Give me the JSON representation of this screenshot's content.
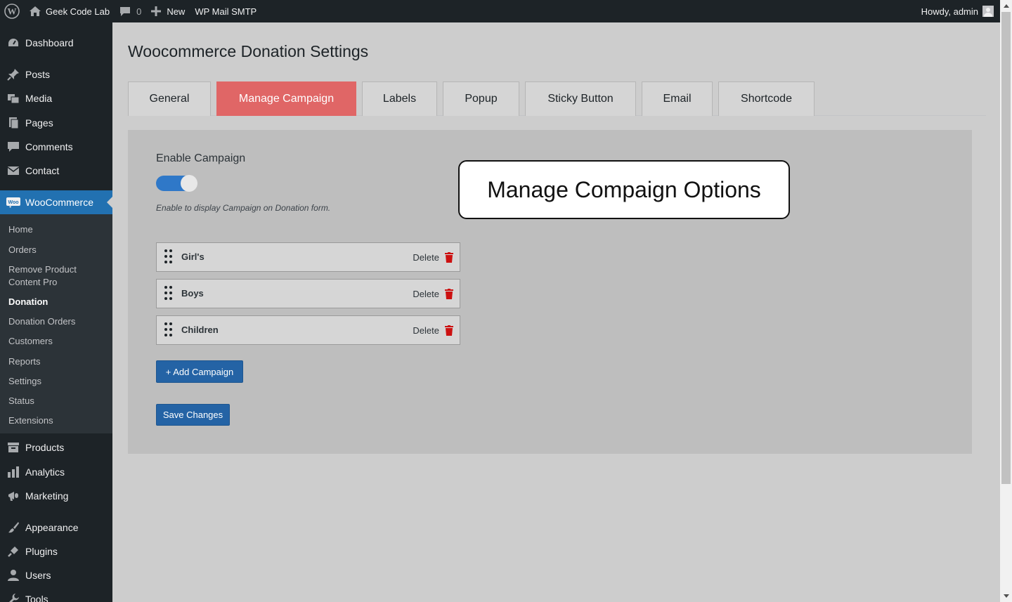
{
  "adminbar": {
    "site_name": "Geek Code Lab",
    "comments_count": "0",
    "new_label": "New",
    "smtp_label": "WP Mail SMTP",
    "howdy": "Howdy, admin"
  },
  "sidebar": {
    "items": {
      "dashboard": "Dashboard",
      "posts": "Posts",
      "media": "Media",
      "pages": "Pages",
      "comments": "Comments",
      "contact": "Contact",
      "woocommerce": "WooCommerce",
      "products": "Products",
      "analytics": "Analytics",
      "marketing": "Marketing",
      "appearance": "Appearance",
      "plugins": "Plugins",
      "users": "Users",
      "tools": "Tools"
    },
    "submenu": {
      "home": "Home",
      "orders": "Orders",
      "remove_product": "Remove Product Content Pro",
      "donation": "Donation",
      "donation_orders": "Donation Orders",
      "customers": "Customers",
      "reports": "Reports",
      "settings": "Settings",
      "status": "Status",
      "extensions": "Extensions"
    }
  },
  "page": {
    "title": "Woocommerce Donation Settings",
    "tabs": {
      "general": "General",
      "manage_campaign": "Manage Campaign",
      "labels": "Labels",
      "popup": "Popup",
      "sticky_button": "Sticky Button",
      "email": "Email",
      "shortcode": "Shortcode"
    },
    "active_tab": "Manage Campaign",
    "enable_campaign": {
      "label": "Enable Campaign",
      "enabled": true,
      "description": "Enable to display Campaign on Donation form."
    },
    "campaigns": [
      {
        "name": "Girl's",
        "delete_label": "Delete"
      },
      {
        "name": "Boys",
        "delete_label": "Delete"
      },
      {
        "name": "Children",
        "delete_label": "Delete"
      }
    ],
    "add_campaign_label": "+ Add Campaign",
    "save_label": "Save Changes",
    "callout_text": "Manage Compaign Options"
  },
  "colors": {
    "admin_dark": "#1d2327",
    "accent_blue": "#2271b1",
    "active_tab": "#e06666",
    "delete_red": "#cc1111"
  }
}
